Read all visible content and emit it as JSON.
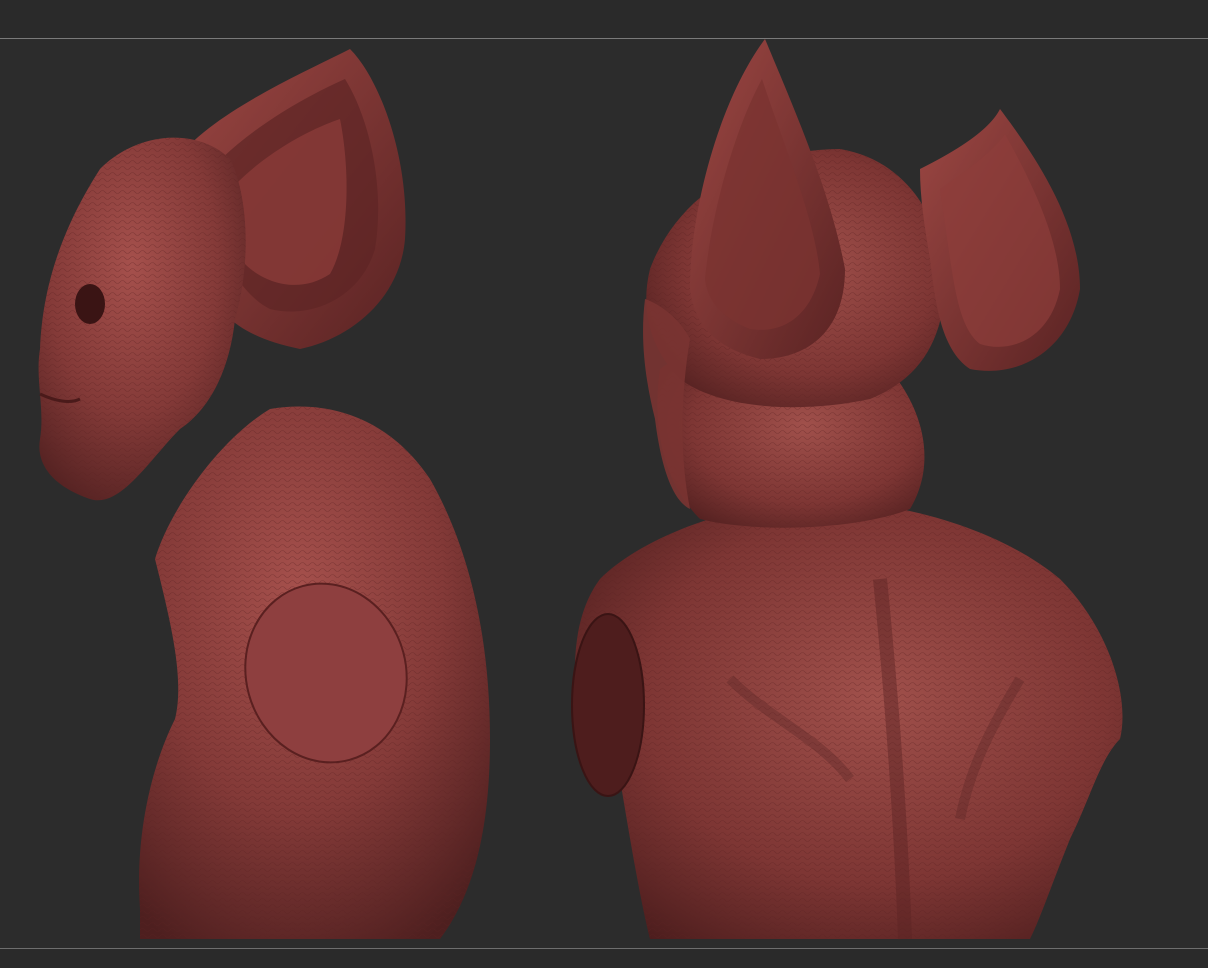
{
  "app": {
    "name": "",
    "background_color": "#2b2b2b",
    "divider_color": "#7a7a7a"
  },
  "viewport": {
    "content": "sculpt-renders",
    "material_color": "#8a3a3a",
    "views": [
      {
        "name": "side-view"
      },
      {
        "name": "back-view"
      }
    ]
  }
}
